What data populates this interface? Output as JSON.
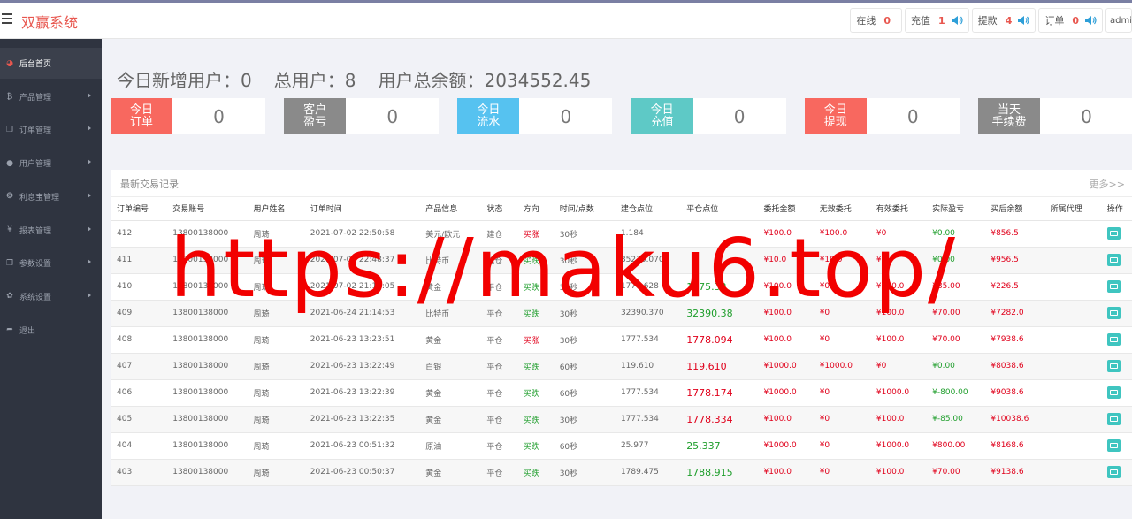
{
  "header": {
    "brand": "双赢系统",
    "stats": [
      {
        "label": "在线",
        "count": "0",
        "sound": false
      },
      {
        "label": "充值",
        "count": "1",
        "sound": true
      },
      {
        "label": "提款",
        "count": "4",
        "sound": true
      },
      {
        "label": "订单",
        "count": "0",
        "sound": true
      }
    ],
    "user": "admin"
  },
  "sidebar": {
    "items": [
      {
        "label": "后台首页",
        "icon": "dashboard-icon",
        "active": true
      },
      {
        "label": "产品管理",
        "icon": "bitcoin-icon"
      },
      {
        "label": "订单管理",
        "icon": "copy-icon"
      },
      {
        "label": "用户管理",
        "icon": "user-icon"
      },
      {
        "label": "利息宝管理",
        "icon": "gift-icon"
      },
      {
        "label": "报表管理",
        "icon": "yen-icon"
      },
      {
        "label": "参数设置",
        "icon": "copy-icon"
      },
      {
        "label": "系统设置",
        "icon": "gears-icon"
      },
      {
        "label": "退出",
        "icon": "sign-out-icon"
      }
    ]
  },
  "summary": {
    "new_users": "今日新增用户：0",
    "total_users": "总用户：8",
    "total_balance": "用户总余额：2034552.45"
  },
  "cards": [
    {
      "label_line1": "今日",
      "label_line2": "订单",
      "value": "0",
      "color": "#f8685f"
    },
    {
      "label_line1": "客户",
      "label_line2": "盈亏",
      "value": "0",
      "color": "#8a8a8a"
    },
    {
      "label_line1": "今日",
      "label_line2": "流水",
      "value": "0",
      "color": "#56c2f0"
    },
    {
      "label_line1": "今日",
      "label_line2": "充值",
      "value": "0",
      "color": "#5ec9c6"
    },
    {
      "label_line1": "今日",
      "label_line2": "提现",
      "value": "0",
      "color": "#f8685f"
    },
    {
      "label_line1": "当天",
      "label_line2": "手续费",
      "value": "0",
      "color": "#8a8a8a"
    }
  ],
  "trades": {
    "title": "最新交易记录",
    "more": "更多>>",
    "columns": [
      "订单编号",
      "交易账号",
      "用户姓名",
      "订单时间",
      "产品信息",
      "状态",
      "方向",
      "时间/点数",
      "建仓点位",
      "平仓点位",
      "委托金额",
      "无效委托",
      "有效委托",
      "实际盈亏",
      "买后余额",
      "所属代理",
      "操作"
    ],
    "rows": [
      {
        "id": "412",
        "account": "13800138000",
        "name": "周琦",
        "time": "2021-07-02 22:50:58",
        "product": "美元/欧元",
        "status": "建仓",
        "direction": "买涨",
        "dir_color": "red",
        "period": "30秒",
        "open": "1.184",
        "close": "",
        "close_color": "",
        "amount": "¥100.0",
        "invalid": "¥100.0",
        "valid": "¥0",
        "pnl": "¥0.00",
        "pnl_color": "green",
        "balance": "¥856.5",
        "agent": ""
      },
      {
        "id": "411",
        "account": "13800138000",
        "name": "周琦",
        "time": "2021-07-02 22:48:37",
        "product": "比特币",
        "status": "建仓",
        "direction": "买跌",
        "dir_color": "green",
        "period": "30秒",
        "open": "35230.070",
        "close": "",
        "close_color": "",
        "amount": "¥10.0",
        "invalid": "¥10.0",
        "valid": "¥0",
        "pnl": "¥0.00",
        "pnl_color": "green",
        "balance": "¥956.5",
        "agent": ""
      },
      {
        "id": "410",
        "account": "13800138000",
        "name": "周琦",
        "time": "2021-07-02 21:19:05",
        "product": "黄金",
        "status": "平仓",
        "direction": "买跌",
        "dir_color": "green",
        "period": "30秒",
        "open": "1776.628",
        "close": "1775.32",
        "close_color": "green",
        "amount": "¥100.0",
        "invalid": "¥0",
        "valid": "¥100.0",
        "pnl": "¥85.00",
        "pnl_color": "red",
        "balance": "¥226.5",
        "agent": ""
      },
      {
        "id": "409",
        "account": "13800138000",
        "name": "周琦",
        "time": "2021-06-24 21:14:53",
        "product": "比特币",
        "status": "平仓",
        "direction": "买跌",
        "dir_color": "green",
        "period": "30秒",
        "open": "32390.370",
        "close": "32390.38",
        "close_color": "green",
        "amount": "¥100.0",
        "invalid": "¥0",
        "valid": "¥100.0",
        "pnl": "¥70.00",
        "pnl_color": "red",
        "balance": "¥7282.0",
        "agent": ""
      },
      {
        "id": "408",
        "account": "13800138000",
        "name": "周琦",
        "time": "2021-06-23 13:23:51",
        "product": "黄金",
        "status": "平仓",
        "direction": "买涨",
        "dir_color": "red",
        "period": "30秒",
        "open": "1777.534",
        "close": "1778.094",
        "close_color": "red",
        "amount": "¥100.0",
        "invalid": "¥0",
        "valid": "¥100.0",
        "pnl": "¥70.00",
        "pnl_color": "red",
        "balance": "¥7938.6",
        "agent": ""
      },
      {
        "id": "407",
        "account": "13800138000",
        "name": "周琦",
        "time": "2021-06-23 13:22:49",
        "product": "白银",
        "status": "平仓",
        "direction": "买跌",
        "dir_color": "green",
        "period": "60秒",
        "open": "119.610",
        "close": "119.610",
        "close_color": "red",
        "amount": "¥1000.0",
        "invalid": "¥1000.0",
        "valid": "¥0",
        "pnl": "¥0.00",
        "pnl_color": "green",
        "balance": "¥8038.6",
        "agent": ""
      },
      {
        "id": "406",
        "account": "13800138000",
        "name": "周琦",
        "time": "2021-06-23 13:22:39",
        "product": "黄金",
        "status": "平仓",
        "direction": "买跌",
        "dir_color": "green",
        "period": "60秒",
        "open": "1777.534",
        "close": "1778.174",
        "close_color": "red",
        "amount": "¥1000.0",
        "invalid": "¥0",
        "valid": "¥1000.0",
        "pnl": "¥-800.00",
        "pnl_color": "green",
        "balance": "¥9038.6",
        "agent": ""
      },
      {
        "id": "405",
        "account": "13800138000",
        "name": "周琦",
        "time": "2021-06-23 13:22:35",
        "product": "黄金",
        "status": "平仓",
        "direction": "买跌",
        "dir_color": "green",
        "period": "30秒",
        "open": "1777.534",
        "close": "1778.334",
        "close_color": "red",
        "amount": "¥100.0",
        "invalid": "¥0",
        "valid": "¥100.0",
        "pnl": "¥-85.00",
        "pnl_color": "green",
        "balance": "¥10038.6",
        "agent": ""
      },
      {
        "id": "404",
        "account": "13800138000",
        "name": "周琦",
        "time": "2021-06-23 00:51:32",
        "product": "原油",
        "status": "平仓",
        "direction": "买跌",
        "dir_color": "green",
        "period": "60秒",
        "open": "25.977",
        "close": "25.337",
        "close_color": "green",
        "amount": "¥1000.0",
        "invalid": "¥0",
        "valid": "¥1000.0",
        "pnl": "¥800.00",
        "pnl_color": "red",
        "balance": "¥8168.6",
        "agent": ""
      },
      {
        "id": "403",
        "account": "13800138000",
        "name": "周琦",
        "time": "2021-06-23 00:50:37",
        "product": "黄金",
        "status": "平仓",
        "direction": "买跌",
        "dir_color": "green",
        "period": "30秒",
        "open": "1789.475",
        "close": "1788.915",
        "close_color": "green",
        "amount": "¥100.0",
        "invalid": "¥0",
        "valid": "¥100.0",
        "pnl": "¥70.00",
        "pnl_color": "red",
        "balance": "¥9138.6",
        "agent": ""
      }
    ]
  },
  "watermark": "https://maku6.top/"
}
